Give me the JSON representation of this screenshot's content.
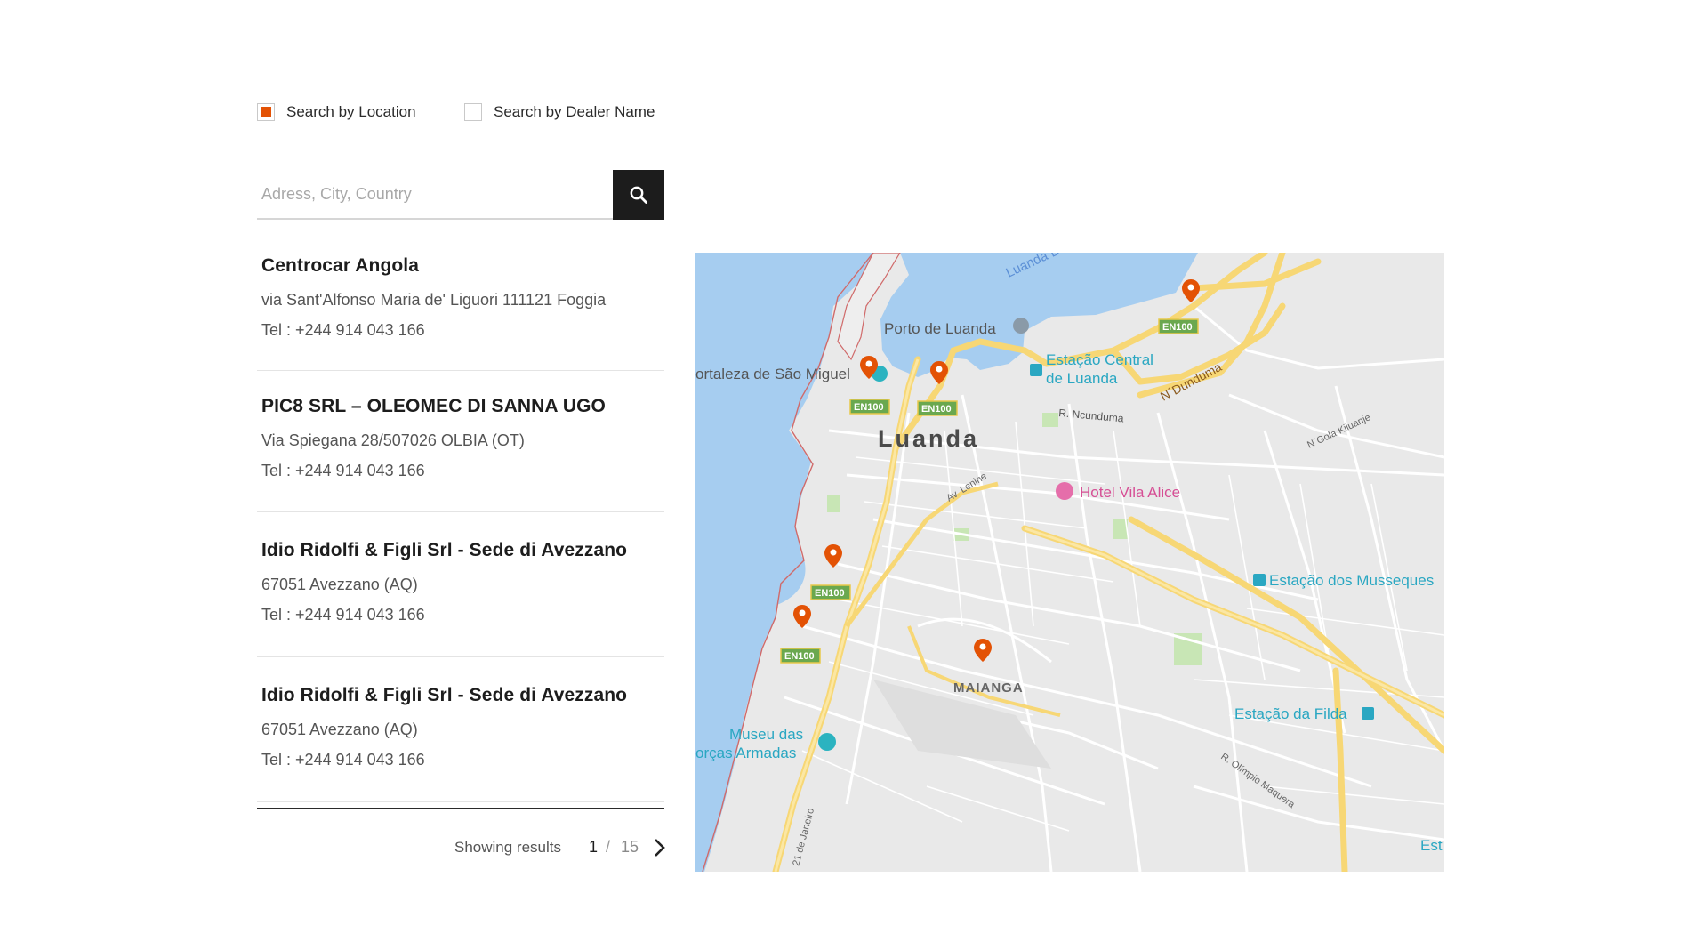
{
  "search_modes": {
    "location": {
      "label": "Search by Location",
      "checked": true
    },
    "dealer_name": {
      "label": "Search by Dealer Name",
      "checked": false
    }
  },
  "search": {
    "placeholder": "Adress, City, Country",
    "value": ""
  },
  "dealers": [
    {
      "name": "Centrocar Angola",
      "address": "via Sant'Alfonso Maria de' Liguori 111121 Foggia",
      "tel": "Tel : +244 914 043 166"
    },
    {
      "name": "PIC8 SRL – OLEOMEC DI SANNA UGO",
      "address": "Via Spiegana 28/507026 OLBIA (OT)",
      "tel": "Tel : +244 914 043 166"
    },
    {
      "name": "Idio Ridolfi & Figli Srl - Sede di Avezzano",
      "address": "67051 Avezzano (AQ)",
      "tel": "Tel : +244 914 043 166"
    },
    {
      "name": "Idio Ridolfi & Figli Srl - Sede di Avezzano",
      "address": "67051 Avezzano (AQ)",
      "tel": "Tel : +244 914 043 166"
    }
  ],
  "pagination": {
    "label": "Showing results",
    "current": "1",
    "separator": "/",
    "total": "15"
  },
  "map": {
    "city": "Luanda",
    "bay": "Luanda Bay",
    "district": "MAIANGA",
    "places": {
      "porto": "Porto de Luanda",
      "fortaleza": "ortaleza de São Miguel",
      "estacao_central_1": "Estação Central",
      "estacao_central_2": "de Luanda",
      "hotel": "Hotel Vila Alice",
      "musseques": "Estação dos Musseques",
      "filda": "Estação da Filda",
      "museu_1": "Museu das",
      "museu_2": "orças Armadas",
      "est": "Est"
    },
    "streets": {
      "ndunduma": "N´Dunduma",
      "r_ncunduma": "R. Ncunduma",
      "gola": "N´Gola Kiluanje",
      "lenine": "Av. Lenine",
      "olimpio": "R. Olímpio Maquera",
      "janeiro": "21 de Janeiro"
    },
    "route_label": "EN100",
    "colors": {
      "water": "#a6cdf0",
      "land": "#e9e9e9",
      "highway": "#f7d775",
      "road": "#ffffff",
      "pin": "#e35205",
      "park": "#c8e6b5"
    },
    "pin_count": 6
  }
}
